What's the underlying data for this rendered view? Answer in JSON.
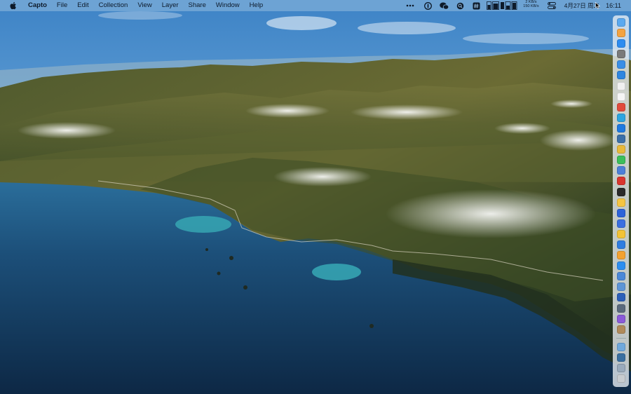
{
  "menubar": {
    "app_name": "Capto",
    "menus": [
      "File",
      "Edit",
      "Collection",
      "View",
      "Layer",
      "Share",
      "Window",
      "Help"
    ],
    "status": {
      "network_up": "2 KB/s",
      "network_down": "150 KB/s",
      "date": "4月27日 周二",
      "time": "16:11"
    }
  },
  "dock": {
    "apps": [
      {
        "icon": "finder-icon",
        "color": "#5aa9f0"
      },
      {
        "icon": "photos-icon",
        "color": "#f4a340"
      },
      {
        "icon": "app-store-icon",
        "color": "#2d8cf0"
      },
      {
        "icon": "system-preferences-icon",
        "color": "#7a7a7a"
      },
      {
        "icon": "mail-icon",
        "color": "#3a8ee6"
      },
      {
        "icon": "safari-icon",
        "color": "#2f86e0"
      },
      {
        "icon": "reminders-icon",
        "color": "#f0f0f0"
      },
      {
        "icon": "calendar-icon",
        "color": "#f5f5f5"
      },
      {
        "icon": "bear-icon",
        "color": "#e14b3c"
      },
      {
        "icon": "telegram-icon",
        "color": "#2ca5e0"
      },
      {
        "icon": "xcode-icon",
        "color": "#1f7ae0"
      },
      {
        "icon": "network-icon",
        "color": "#3b6fa8"
      },
      {
        "icon": "chrome-icon",
        "color": "#e8b93a"
      },
      {
        "icon": "wechat-icon",
        "color": "#3bbf5a"
      },
      {
        "icon": "vpn-icon",
        "color": "#4c7fd8"
      },
      {
        "icon": "flag-app-icon",
        "color": "#d9362f"
      },
      {
        "icon": "terminal-icon",
        "color": "#2a2a2a"
      },
      {
        "icon": "notes-icon",
        "color": "#f5c542"
      },
      {
        "icon": "butterfly-app-icon",
        "color": "#2c63d9"
      },
      {
        "icon": "translate-icon",
        "color": "#3a6fe0"
      },
      {
        "icon": "capture-icon",
        "color": "#f2c338"
      },
      {
        "icon": "pen-app-icon",
        "color": "#2f7de0"
      },
      {
        "icon": "emoji-app-icon",
        "color": "#f3a230"
      },
      {
        "icon": "browser-icon",
        "color": "#2c8ef0"
      },
      {
        "icon": "dev-tool-icon",
        "color": "#4a88d8"
      },
      {
        "icon": "preview-icon",
        "color": "#5d95d6"
      },
      {
        "icon": "word-icon",
        "color": "#2b5fb8"
      },
      {
        "icon": "grid-app-icon",
        "color": "#5a6a7d"
      },
      {
        "icon": "colorful-app-icon",
        "color": "#8a5ad8"
      },
      {
        "icon": "keychain-icon",
        "color": "#b08a5a"
      }
    ],
    "trailing": [
      {
        "icon": "folder-icon",
        "color": "#6fa8dc"
      },
      {
        "icon": "screen-icon",
        "color": "#3a6fa0"
      },
      {
        "icon": "downloads-icon",
        "color": "#9ab"
      },
      {
        "icon": "trash-icon",
        "color": "#c8ccd0"
      }
    ]
  }
}
